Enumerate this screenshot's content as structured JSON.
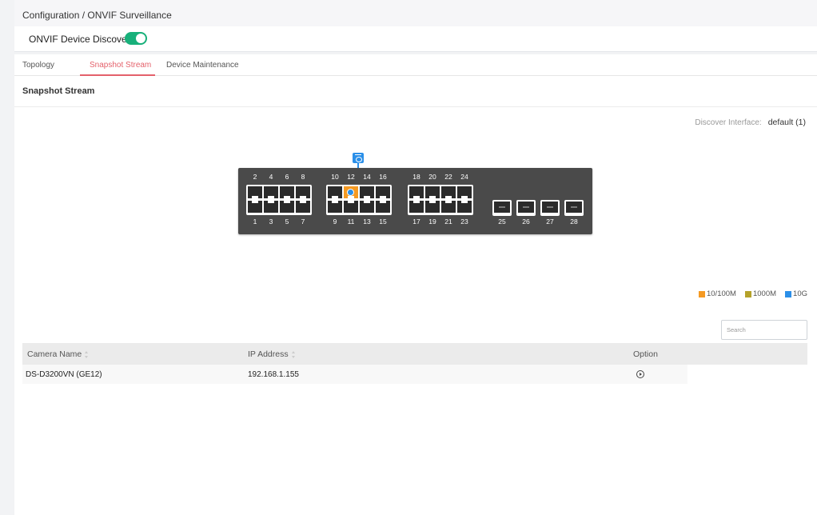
{
  "breadcrumb": "Configuration / ONVIF Surveillance",
  "discovery": {
    "label": "ONVIF Device Discovery",
    "enabled": true
  },
  "tabs": [
    {
      "label": "Topology",
      "active": false
    },
    {
      "label": "Snapshot Stream",
      "active": true
    },
    {
      "label": "Device Maintenance",
      "active": false
    }
  ],
  "section_title": "Snapshot Stream",
  "discover_interface": {
    "label": "Discover Interface:",
    "value": "default (1)"
  },
  "switch": {
    "top_ports": [
      "2",
      "4",
      "6",
      "8",
      "10",
      "12",
      "14",
      "16",
      "18",
      "20",
      "22",
      "24"
    ],
    "bottom_ports": [
      "1",
      "3",
      "5",
      "7",
      "9",
      "11",
      "13",
      "15",
      "17",
      "19",
      "21",
      "23"
    ],
    "sfp_ports": [
      "25",
      "26",
      "27",
      "28"
    ],
    "active_port": "12"
  },
  "legend": [
    {
      "label": "10/100M",
      "color": "#f59a23"
    },
    {
      "label": "1000M",
      "color": "#b5a22a"
    },
    {
      "label": "10G",
      "color": "#2b8fe8"
    }
  ],
  "search": {
    "placeholder": "Search"
  },
  "table": {
    "columns": [
      "Camera Name",
      "IP Address",
      "Option"
    ],
    "rows": [
      {
        "name": "DS-D3200VN (GE12)",
        "ip": "192.168.1.155"
      }
    ]
  }
}
